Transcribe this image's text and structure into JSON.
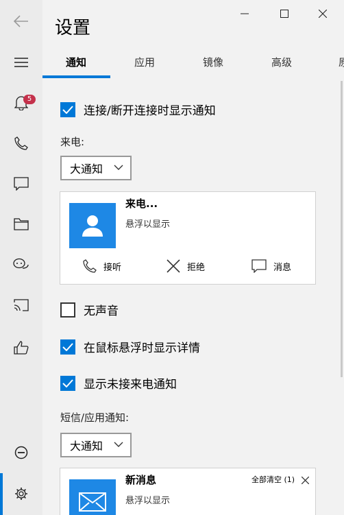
{
  "window": {
    "title": "设置"
  },
  "sidebar": {
    "badge_count": "5"
  },
  "tabs": [
    {
      "label": "通知"
    },
    {
      "label": "应用"
    },
    {
      "label": "镜像"
    },
    {
      "label": "高级"
    },
    {
      "label": "原"
    }
  ],
  "settings": {
    "connect_notify": {
      "label": "连接/断开连接时显示通知",
      "checked": true
    },
    "incoming_call_label": "来电:",
    "incoming_call_dropdown": "大通知",
    "call_preview": {
      "title": "来电...",
      "subtitle": "悬浮以显示",
      "answer": "接听",
      "decline": "拒绝",
      "message": "消息"
    },
    "mute": {
      "label": "无声音",
      "checked": false
    },
    "hover_details": {
      "label": "在鼠标悬浮时显示详情",
      "checked": true
    },
    "missed_call": {
      "label": "显示未接来电通知",
      "checked": true
    },
    "sms_label": "短信/应用通知:",
    "sms_dropdown": "大通知",
    "msg_preview": {
      "title": "新消息",
      "subtitle": "悬浮以显示",
      "clear_all": "全部清空 (1)"
    }
  },
  "colors": {
    "accent": "#0078d7",
    "badge": "#c4314b",
    "avatar": "#1e88e5"
  }
}
